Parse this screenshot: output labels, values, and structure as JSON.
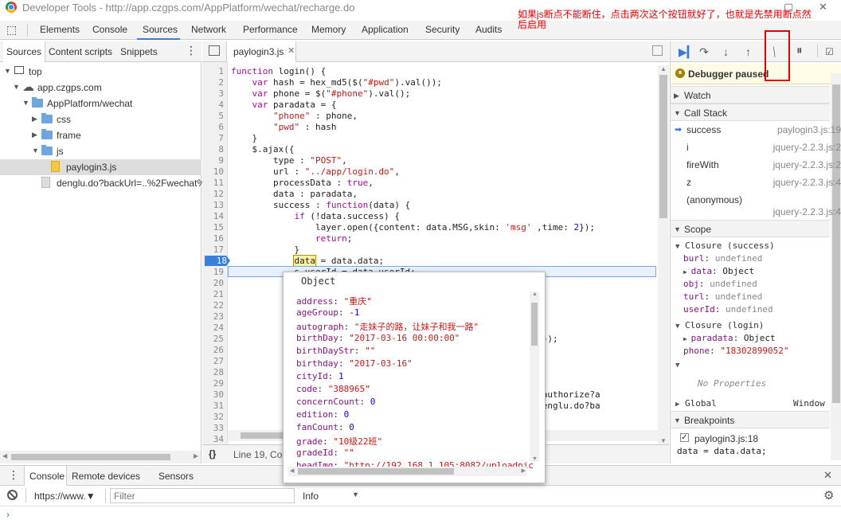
{
  "window": {
    "title": "Developer Tools - http://app.czgps.com/AppPlatform/wechat/recharge.do"
  },
  "annotation": {
    "note": "如果js断点不能断住，点击两次这个按钮就好了，也就是先禁用断点然后启用"
  },
  "tabs": [
    "Elements",
    "Console",
    "Sources",
    "Network",
    "Performance",
    "Memory",
    "Application",
    "Security",
    "Audits"
  ],
  "left_tabs": [
    "Sources",
    "Content scripts",
    "Snippets"
  ],
  "tree": {
    "top": "top",
    "domain": "app.czgps.com",
    "folder": "AppPlatform/wechat",
    "css": "css",
    "frame": "frame",
    "js": "js",
    "file_js": "paylogin3.js",
    "file_other": "denglu.do?backUrl=..%2Fwechat%"
  },
  "editor": {
    "file_tab": "paylogin3.js",
    "status": "Line 19, Col",
    "lines": [
      {
        "n": "1",
        "html": "<span class='kw'>function</span> login() {"
      },
      {
        "n": "2",
        "html": "    <span class='kw'>var</span> hash = hex_md5($(<span class='str'>\"#pwd\"</span>).val());"
      },
      {
        "n": "3",
        "html": "    <span class='kw'>var</span> phone = $(<span class='str'>\"#phone\"</span>).val();"
      },
      {
        "n": "4",
        "html": "    <span class='kw'>var</span> paradata = {"
      },
      {
        "n": "5",
        "html": "        <span class='str'>\"phone\"</span> : phone,"
      },
      {
        "n": "6",
        "html": "        <span class='str'>\"pwd\"</span> : hash"
      },
      {
        "n": "7",
        "html": "    }"
      },
      {
        "n": "8",
        "html": "    $.ajax({"
      },
      {
        "n": "9",
        "html": "        type : <span class='str'>\"POST\"</span>,"
      },
      {
        "n": "10",
        "html": "        url : <span class='str'>\"../app/login.do\"</span>,"
      },
      {
        "n": "11",
        "html": "        processData : <span class='kw'>true</span>,"
      },
      {
        "n": "12",
        "html": "        data : paradata,"
      },
      {
        "n": "13",
        "html": "        success : <span class='kw'>function</span>(data) {"
      },
      {
        "n": "14",
        "html": "            <span class='kw'>if</span> (!data.success) {"
      },
      {
        "n": "15",
        "html": "                layer.open({content: data.MSG,skin: <span class='str'>'msg'</span> ,time: <span class='fn'>2</span>});"
      },
      {
        "n": "16",
        "html": "                <span class='kw'>return</span>;"
      },
      {
        "n": "17",
        "html": "            }"
      },
      {
        "n": "18",
        "html": "            <span style='background:#fff2a8;outline:1px solid #b58a00'>data</span> = data.data;"
      },
      {
        "n": "19",
        "html": "            s.userId = data.userId;"
      },
      {
        "n": "20",
        "html": ""
      },
      {
        "n": "21",
        "html": ""
      },
      {
        "n": "22",
        "html": ""
      },
      {
        "n": "23",
        "html": ""
      },
      {
        "n": "24",
        "html": ""
      },
      {
        "n": "25",
        "html": "                                                     me: <span class='fn'>2</span> });"
      },
      {
        "n": "26",
        "html": ""
      },
      {
        "n": "27",
        "html": ""
      },
      {
        "n": "28",
        "html": ""
      },
      {
        "n": "29",
        "html": ""
      },
      {
        "n": "30",
        "html": "                                                 ct/oauth2/authorize?a"
      },
      {
        "n": "31",
        "html": "                                                 m/wechat/denglu.do?ba"
      },
      {
        "n": "32",
        "html": "                                                 );"
      },
      {
        "n": "33",
        "html": ""
      },
      {
        "n": "34",
        "html": ""
      }
    ]
  },
  "popover": {
    "title": "Object",
    "rows": [
      {
        "k": "address",
        "v": "\"重庆\"",
        "t": "s"
      },
      {
        "k": "ageGroup",
        "v": "-1",
        "t": "n"
      },
      {
        "k": "autograph",
        "v": "\"走妹子的路，让妹子和我一路\"",
        "t": "s"
      },
      {
        "k": "birthDay",
        "v": "\"2017-03-16 00:00:00\"",
        "t": "s"
      },
      {
        "k": "birthDayStr",
        "v": "\"\"",
        "t": "s"
      },
      {
        "k": "birthday",
        "v": "\"2017-03-16\"",
        "t": "s"
      },
      {
        "k": "cityId",
        "v": "1",
        "t": "n"
      },
      {
        "k": "code",
        "v": "\"388965\"",
        "t": "s"
      },
      {
        "k": "concernCount",
        "v": "0",
        "t": "n"
      },
      {
        "k": "edition",
        "v": "0",
        "t": "n"
      },
      {
        "k": "fanCount",
        "v": "0",
        "t": "n"
      },
      {
        "k": "grade",
        "v": "\"10级22班\"",
        "t": "s"
      },
      {
        "k": "gradeId",
        "v": "\"\"",
        "t": "s"
      },
      {
        "k": "headImg",
        "v": "\"http://192.168.1.105:8082/uploadpic",
        "t": "s"
      }
    ]
  },
  "debugger": {
    "paused": "Debugger paused",
    "watch": "Watch",
    "callstack": "Call Stack",
    "frames": [
      {
        "name": "success",
        "loc": "paylogin3.js:19"
      },
      {
        "name": "i",
        "loc": "jquery-2.2.3.js:2"
      },
      {
        "name": "fireWith",
        "loc": "jquery-2.2.3.js:2"
      },
      {
        "name": "z",
        "loc": "jquery-2.2.3.js:4"
      },
      {
        "name": "(anonymous)",
        "loc": "jquery-2.2.3.js:4"
      }
    ],
    "scope": "Scope",
    "closure_success": "Closure (success)",
    "scope_vars": [
      {
        "k": "burl",
        "v": "undefined"
      },
      {
        "k": "data",
        "v": "Object"
      },
      {
        "k": "obj",
        "v": "undefined"
      },
      {
        "k": "turl",
        "v": "undefined"
      },
      {
        "k": "userId",
        "v": "undefined"
      }
    ],
    "closure_login": "Closure (login)",
    "login_vars": [
      {
        "k": "paradata",
        "v": "Object"
      },
      {
        "k": "phone",
        "v": "\"18302899052\""
      }
    ],
    "no_props": "No Properties",
    "global": "Global",
    "global_val": "Window",
    "breakpoints": "Breakpoints",
    "bp_file": "paylogin3.js:18",
    "bp_code": "data = data.data;"
  },
  "console": {
    "tabs": [
      "Console",
      "Remote devices",
      "Sensors"
    ],
    "context": "https://www.▼",
    "filter_placeholder": "Filter",
    "level": "Info"
  }
}
